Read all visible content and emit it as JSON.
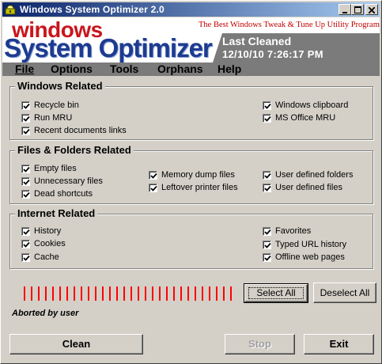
{
  "window": {
    "title": "Windows System Optimizer 2.0",
    "controls": {
      "minimize": "_",
      "maximize": "□",
      "close": "×"
    }
  },
  "banner": {
    "logo_windows": "windows",
    "logo_system": "System Optimizer",
    "tagline": "The Best  Windows Tweak &  Tune Up Utility Program",
    "last_cleaned_title": "Last Cleaned",
    "last_cleaned_date": "12/10/10  7:26:17 PM"
  },
  "menu": {
    "file": "File",
    "options": "Options",
    "tools": "Tools",
    "orphans": "Orphans",
    "help": "Help"
  },
  "groups": {
    "windows": {
      "title": "Windows Related",
      "items": [
        {
          "label": "Recycle bin",
          "checked": true
        },
        {
          "label": "Run MRU",
          "checked": true
        },
        {
          "label": "Recent documents links",
          "checked": true
        },
        {
          "label": "Windows clipboard",
          "checked": true
        },
        {
          "label": "MS Office MRU",
          "checked": true
        }
      ]
    },
    "files": {
      "title": "Files & Folders Related",
      "items": [
        {
          "label": "Empty files",
          "checked": true
        },
        {
          "label": "Unnecessary files",
          "checked": true
        },
        {
          "label": "Dead shortcuts",
          "checked": true
        },
        {
          "label": "Memory dump files",
          "checked": true
        },
        {
          "label": "Leftover printer files",
          "checked": true
        },
        {
          "label": "User defined folders",
          "checked": true
        },
        {
          "label": "User defined files",
          "checked": true
        }
      ]
    },
    "internet": {
      "title": "Internet Related",
      "items": [
        {
          "label": "History",
          "checked": true
        },
        {
          "label": "Cookies",
          "checked": true
        },
        {
          "label": "Cache",
          "checked": true
        },
        {
          "label": "Favorites",
          "checked": true
        },
        {
          "label": "Typed URL history",
          "checked": true
        },
        {
          "label": "Offline web pages",
          "checked": true
        }
      ]
    }
  },
  "buttons": {
    "select_all": "Select All",
    "deselect_all": "Deselect All",
    "clean": "Clean",
    "stop": "Stop",
    "exit": "Exit"
  },
  "status": {
    "message": "Aborted by user",
    "progress_ticks": 30
  },
  "colors": {
    "title_gradient_start": "#0a246a",
    "title_gradient_end": "#a6caf0",
    "logo_red": "#c9161c",
    "logo_blue": "#1d3b8f",
    "progress_red": "#ff0000",
    "panel_gray": "#7b7b7b"
  }
}
